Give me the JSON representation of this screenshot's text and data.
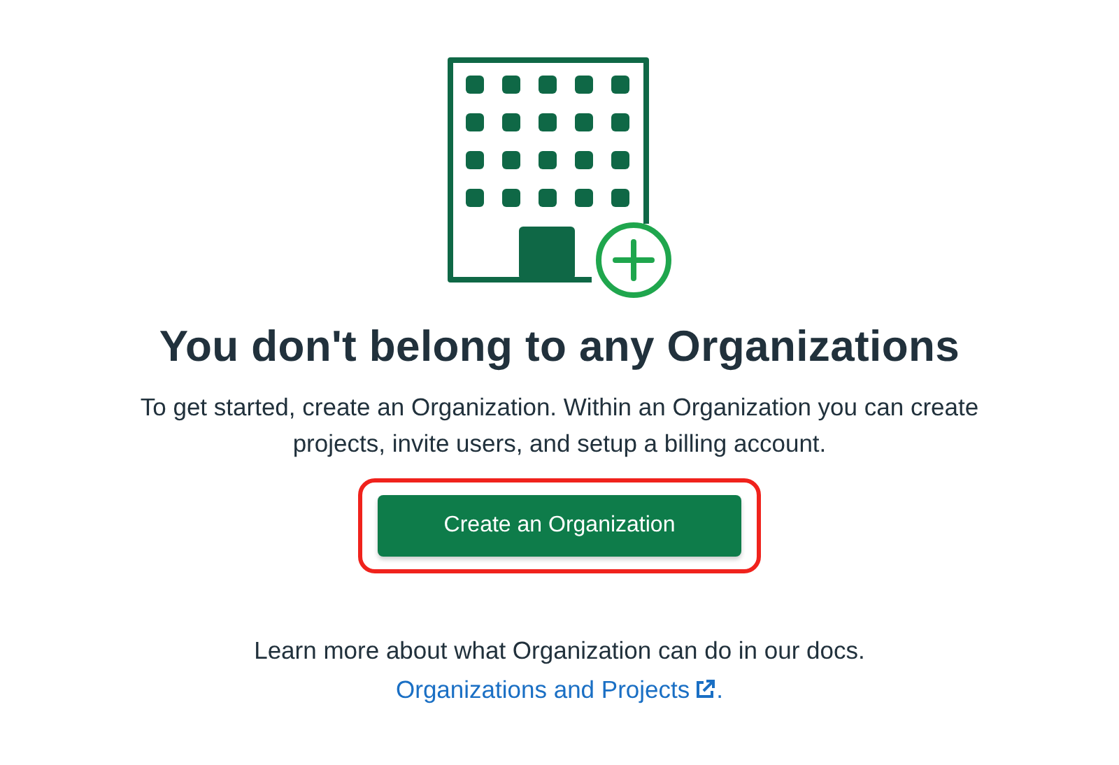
{
  "empty_state": {
    "title": "You don't belong to any Organizations",
    "description": "To get started, create an Organization. Within an Organization you can create projects, invite users, and setup a billing account.",
    "button": {
      "label": "Create an Organization",
      "highlighted": true
    },
    "learn_more": "Learn more about what Organization can do in our docs.",
    "docs_link": {
      "label": "Organizations and Projects",
      "external": true,
      "trailing": "."
    }
  }
}
